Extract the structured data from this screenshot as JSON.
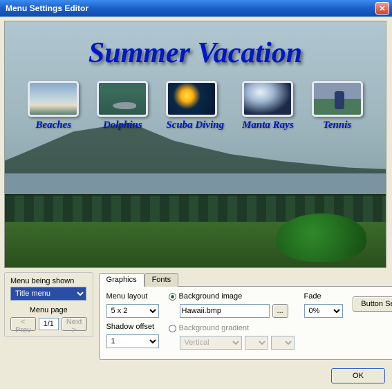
{
  "window": {
    "title": "Menu Settings Editor"
  },
  "preview": {
    "title": "Summer Vacation",
    "thumbs": [
      {
        "label": "Beaches"
      },
      {
        "label": "Dolphins"
      },
      {
        "label": "Scuba Diving"
      },
      {
        "label": "Manta Rays"
      },
      {
        "label": "Tennis"
      }
    ]
  },
  "left_panel": {
    "menu_shown_label": "Menu being shown",
    "menu_shown_value": "Title menu",
    "menu_page_label": "Menu page",
    "prev": "< Prev",
    "page": "1/1",
    "next": "Next >"
  },
  "tabs": {
    "graphics": "Graphics",
    "fonts": "Fonts"
  },
  "graphics": {
    "layout_label": "Menu layout",
    "layout_value": "5 x 2",
    "shadow_label": "Shadow offset",
    "shadow_value": "1",
    "bg_image_label": "Background image",
    "bg_image_value": "Hawaii.bmp",
    "browse": "...",
    "bg_gradient_label": "Background gradient",
    "gradient_dir": "Vertical",
    "fade_label": "Fade",
    "fade_value": "0%",
    "button_settings": "Button Settings"
  },
  "footer": {
    "ok": "OK"
  }
}
